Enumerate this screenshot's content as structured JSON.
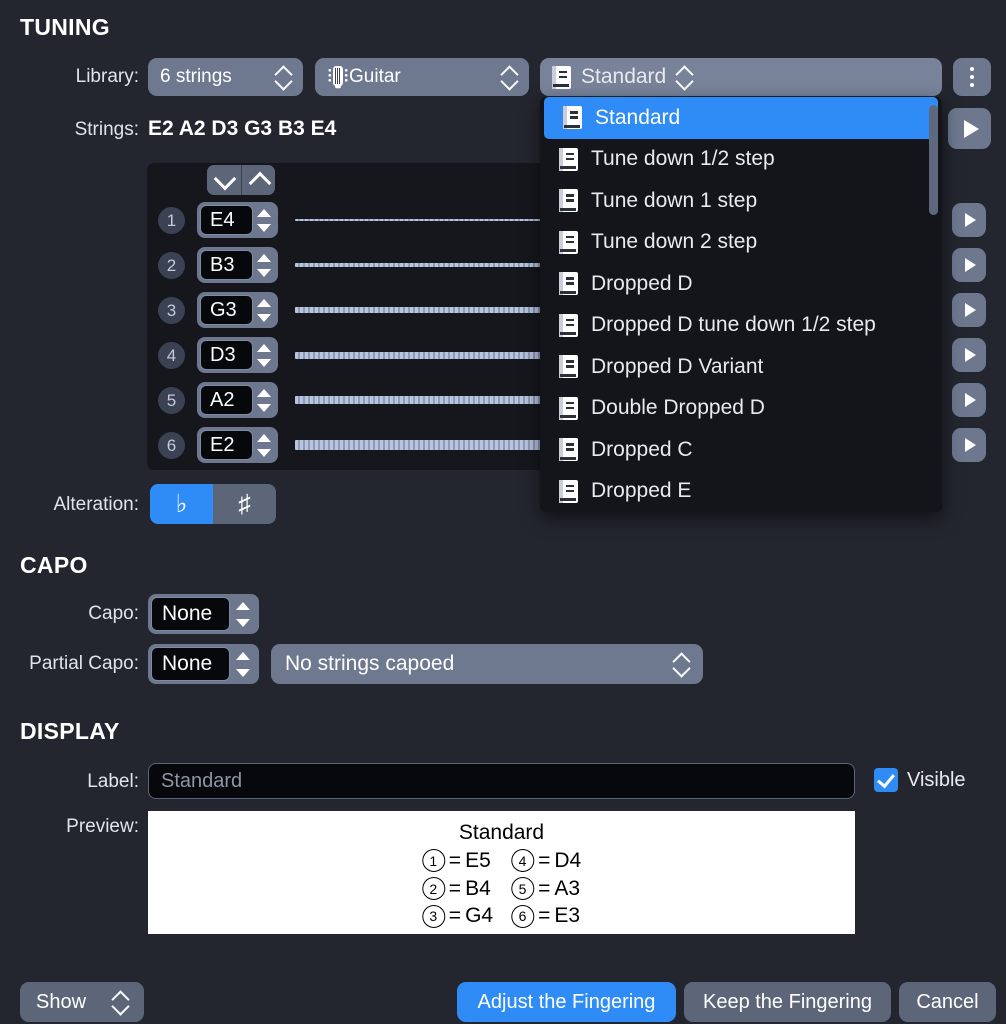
{
  "sections": {
    "tuning": "TUNING",
    "capo": "CAPO",
    "display": "DISPLAY"
  },
  "labels": {
    "library": "Library:",
    "strings": "Strings:",
    "alteration": "Alteration:",
    "capo": "Capo:",
    "partial_capo": "Partial Capo:",
    "label": "Label:",
    "preview": "Preview:"
  },
  "library": {
    "count_value": "6 strings",
    "instrument_value": "Guitar",
    "instrument_icon": "guitar-headstock-icon"
  },
  "strings_summary": "E2 A2 D3 G3 B3 E4",
  "string_rows": [
    {
      "index": "1",
      "note": "E4"
    },
    {
      "index": "2",
      "note": "B3"
    },
    {
      "index": "3",
      "note": "G3"
    },
    {
      "index": "4",
      "note": "D3"
    },
    {
      "index": "5",
      "note": "A2"
    },
    {
      "index": "6",
      "note": "E2"
    }
  ],
  "alteration": {
    "flat": "♭",
    "sharp": "♯",
    "selected": "flat"
  },
  "capo_section": {
    "capo_value": "None",
    "partial_capo_value": "None",
    "partial_capo_detail": "No strings capoed"
  },
  "display_section": {
    "label_value": "Standard",
    "visible_checkbox": "Visible",
    "visible_checked": true
  },
  "preview": {
    "title": "Standard",
    "entries": [
      {
        "num": "①",
        "note": "E5"
      },
      {
        "num": "④",
        "note": "D4"
      },
      {
        "num": "②",
        "note": "B4"
      },
      {
        "num": "⑤",
        "note": "A3"
      },
      {
        "num": "③",
        "note": "G4"
      },
      {
        "num": "⑥",
        "note": "E3"
      }
    ],
    "equals": "="
  },
  "tuning_dropdown": {
    "selected": "Standard",
    "items": [
      "Standard",
      "Tune down 1/2 step",
      "Tune down 1 step",
      "Tune down 2 step",
      "Dropped D",
      "Dropped D tune down 1/2 step",
      "Dropped D Variant",
      "Double Dropped D",
      "Dropped C",
      "Dropped E"
    ],
    "item_icon": "book-icon",
    "open": true
  },
  "footer": {
    "show": "Show",
    "adjust": "Adjust the Fingering",
    "keep": "Keep the Fingering",
    "cancel": "Cancel"
  },
  "colors": {
    "background": "#23262e",
    "accent": "#2f8cf7",
    "control": "#6d788f",
    "panel": "#15171d",
    "field": "#07080c"
  }
}
